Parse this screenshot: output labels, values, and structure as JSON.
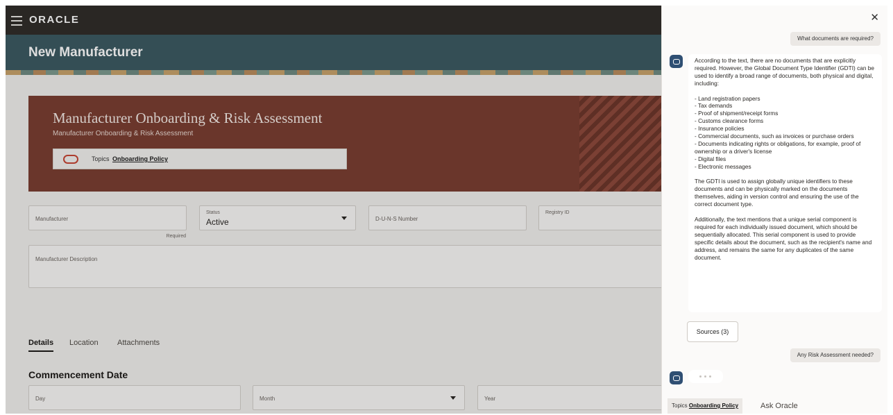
{
  "app": {
    "logo": "ORACLE"
  },
  "header": {
    "title": "New Manufacturer"
  },
  "banner": {
    "title": "Manufacturer Onboarding & Risk Assessment",
    "subtitle": "Manufacturer Onboarding & Risk Assessment",
    "topic_prefix": "Topics",
    "topic_link": "Onboarding Policy"
  },
  "form": {
    "manufacturer": {
      "label": "Manufacturer",
      "required": "Required"
    },
    "status": {
      "label": "Status",
      "value": "Active"
    },
    "duns": {
      "label": "D-U-N-S Number"
    },
    "registry": {
      "label": "Registry ID"
    },
    "description": {
      "label": "Manufacturer Description"
    }
  },
  "tabs": [
    "Details",
    "Location",
    "Attachments"
  ],
  "section": {
    "title": "Commencement Date",
    "day": "Day",
    "month": "Month",
    "year": "Year"
  },
  "chat": {
    "user_question_1": "What documents are required?",
    "answer": {
      "intro": "According to the text, there are no documents that are explicitly required. However, the Global Document Type Identifier (GDTI) can be used to identify a broad range of documents, both physical and digital, including:",
      "items": [
        "- Land registration papers",
        "- Tax demands",
        "- Proof of shipment/receipt forms",
        "- Customs clearance forms",
        "- Insurance policies",
        "- Commercial documents, such as invoices or purchase orders",
        "- Documents indicating rights or obligations, for example, proof of ownership or a driver's license",
        "- Digital files",
        "- Electronic messages"
      ],
      "para2": "The GDTI is used to assign globally unique identifiers to these documents and can be physically marked on the documents themselves, aiding in version control and ensuring the use of the correct document type.",
      "para3": "Additionally, the text mentions that a unique serial component is required for each individually issued document, which should be sequentially allocated. This serial component is used to provide specific details about the document, such as the recipient's name and address, and remains the same for any duplicates of the same document."
    },
    "sources_label": "Sources (3)",
    "user_question_2": "Any Risk Assessment needed?",
    "footer_topic_prefix": "Topics",
    "footer_topic_link": "Onboarding Policy",
    "input_placeholder": "Ask Oracle"
  },
  "icons": {
    "menu": "hamburger-menu-icon",
    "close": "close-icon",
    "bot": "oracle-assistant-icon",
    "dropdown": "chevron-down-icon"
  },
  "colors": {
    "topbar": "#312d2a",
    "header": "#3c5a62",
    "banner": "#7a3e32",
    "accent": "#c74634"
  }
}
